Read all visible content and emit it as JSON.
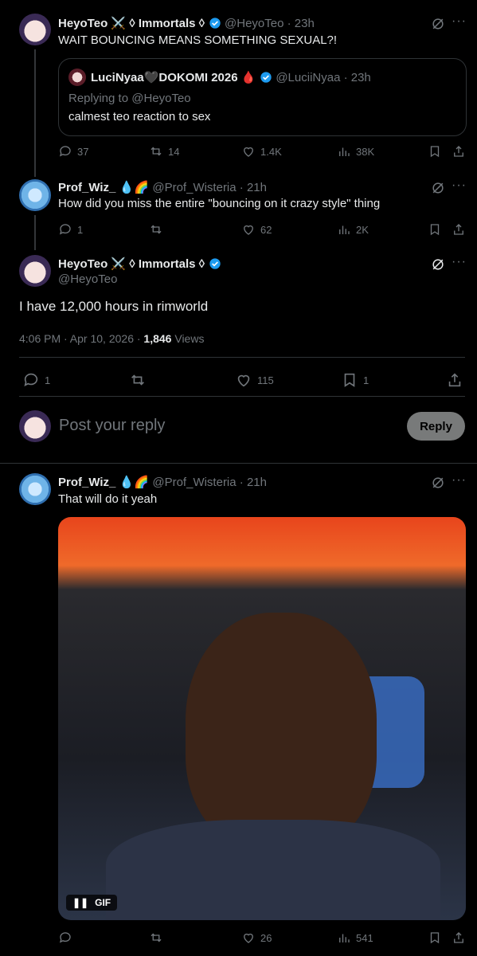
{
  "tweet1": {
    "name": "HeyoTeo ⚔️ ◊ Immortals ◊",
    "handle_time": "@HeyoTeo · 23h",
    "text": "WAIT BOUNCING MEANS SOMETHING SEXUAL?!",
    "quote": {
      "name": "LuciNyaa🖤DOKOMI 2026 🩸",
      "handle_time": "@LuciiNyaa · 23h",
      "replying": "Replying to @HeyoTeo",
      "text": "calmest teo reaction to sex"
    },
    "stats": {
      "replies": "37",
      "reposts": "14",
      "likes": "1.4K",
      "views": "38K"
    }
  },
  "tweet2": {
    "name": "Prof_Wiz_ 💧🌈",
    "handle_time": "@Prof_Wisteria · 21h",
    "text": "How did you miss the entire \"bouncing on it crazy style\" thing",
    "stats": {
      "replies": "1",
      "reposts": "",
      "likes": "62",
      "views": "2K"
    }
  },
  "main": {
    "name": "HeyoTeo ⚔️ ◊ Immortals ◊",
    "handle": "@HeyoTeo",
    "text": "I have 12,000 hours in rimworld",
    "time": "4:06 PM · Apr 10, 2026 · ",
    "views_count": "1,846",
    "views_label": "Views",
    "stats": {
      "replies": "1",
      "reposts": "",
      "likes": "115",
      "bookmarks": "1"
    }
  },
  "compose": {
    "placeholder": "Post your reply",
    "button": "Reply"
  },
  "reply": {
    "name": "Prof_Wiz_ 💧🌈",
    "handle_time": "@Prof_Wisteria · 21h",
    "text": "That will do it yeah",
    "gif_label": "GIF",
    "stats": {
      "replies": "",
      "reposts": "",
      "likes": "26",
      "views": "541"
    }
  },
  "colors": {
    "accent": "#1d9bf0",
    "muted": "#71767b",
    "border": "#2f3336"
  }
}
